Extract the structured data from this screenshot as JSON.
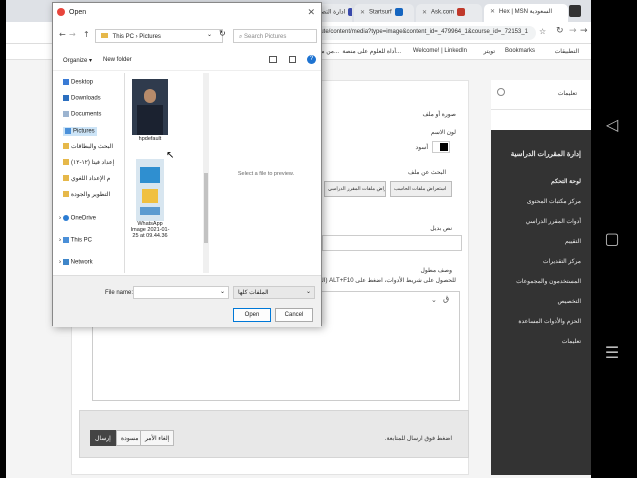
{
  "browser": {
    "tabs": [
      {
        "label": "Hex | MSN السعودية",
        "icon_color": "#2d7ff9"
      },
      {
        "label": "Ask.com",
        "icon_color": "#c0392b"
      },
      {
        "label": "Startsurf",
        "icon_color": "#1565c0"
      },
      {
        "label": "ادارة التصحيح من",
        "icon_color": "#3949ab"
      }
    ],
    "url": "ecute/content/media?type=image&content_id=_479964_1&course_id=_72153_1",
    "bookmarks": [
      "التطبيقات",
      "Bookmarks",
      "تويتر",
      "Welcome! | LinkedIn",
      "أداة للعلوم على منصة...",
      "من مكتبة أ..."
    ]
  },
  "page": {
    "image_label": "صورة أو ملف",
    "color_label": "لون الاسم",
    "color_value": "أسود",
    "browse_label": "البحث عن ملف",
    "browse_my_computer": "استعراض ملفات الحاسب",
    "browse_content": "استعراض ملفات المقرر الدراسي",
    "alt_text_label": "نص بديل",
    "description_label": "وصف مطول",
    "description_hint": "للحصول على شريط الأدوات، اضغط على ALT+F10 (الكمبيوتر الشخصي)",
    "footer_hint": "اضغط فوق ارسال للمتابعة.",
    "submit": "إرسال",
    "cancel": "إلغاء الأمر",
    "save": "مسودة"
  },
  "sidebar": {
    "notifications": "تعليمات",
    "menu_title": "إدارة المقررات الدراسية",
    "items": [
      "لوحة التحكم",
      "مركز مكتبات المحتوى",
      "أدوات المقرر الدراسي",
      "التقييم",
      "مركز التقديرات",
      "المستخدمون والمجموعات",
      "التخصيص",
      "الحزم والأدوات المساعدة",
      "تعليمات"
    ]
  },
  "dialog": {
    "title": "Open",
    "path": [
      "This PC",
      "Pictures"
    ],
    "search_placeholder": "Search Pictures",
    "organize": "Organize ▾",
    "new_folder": "New folder",
    "tree": [
      "Desktop",
      "Downloads",
      "Documents",
      "Pictures",
      "البحث والبطاقات",
      "إعداد فيتا (١٢-١٢)",
      "م الإعداد اللغوي",
      "التطوير والجودة",
      "OneDrive",
      "This PC",
      "Network"
    ],
    "files": [
      {
        "name": "hpdefault"
      },
      {
        "name": "WhatsApp Image 2021-01-25 at 09.44.36"
      }
    ],
    "preview_text": "Select a file to preview.",
    "file_name_label": "File name:",
    "file_type": "الملفات كلها",
    "open": "Open",
    "cancel": "Cancel"
  }
}
